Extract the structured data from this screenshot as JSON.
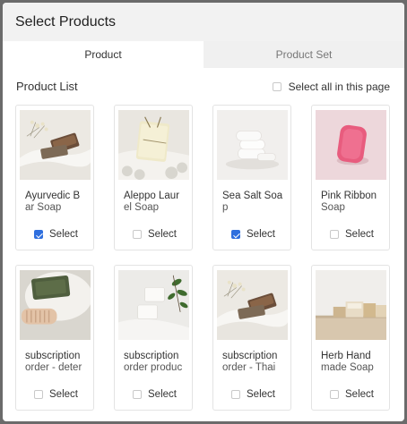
{
  "modal": {
    "title": "Select Products"
  },
  "tabs": [
    {
      "label": "Product",
      "active": true
    },
    {
      "label": "Product Set",
      "active": false
    }
  ],
  "list": {
    "title": "Product List",
    "select_all_label": "Select all in this page",
    "select_all_checked": false
  },
  "select_label": "Select",
  "products": [
    {
      "name": "Ayurvedic Bar Soap",
      "line1": "Ayurvedic B",
      "line2": "ar Soap",
      "checked": true,
      "image": "soap-on-towel-with-flowers"
    },
    {
      "name": "Aleppo Laurel Soap",
      "line1": "Aleppo Laur",
      "line2": "el Soap",
      "checked": false,
      "image": "cream-soap-with-twine"
    },
    {
      "name": "Sea Salt Soap",
      "line1": "Sea Salt Soa",
      "line2": "p",
      "checked": true,
      "image": "stacked-white-soaps"
    },
    {
      "name": "Pink Ribbon Soap",
      "line1": "Pink Ribbon",
      "line2": "Soap",
      "checked": false,
      "image": "pink-soap-bar"
    },
    {
      "name": "subscription order - detergent soap",
      "line1": "subscription",
      "line2": "order - deter",
      "checked": false,
      "image": "green-soap-with-brush"
    },
    {
      "name": "subscription order product - facial soap",
      "line1": "subscription",
      "line2": "order produc",
      "checked": false,
      "image": "white-soaps-with-leaves"
    },
    {
      "name": "subscription order - Thai soap",
      "line1": "subscription",
      "line2": "order - Thai",
      "checked": false,
      "image": "soap-on-towel-with-flowers"
    },
    {
      "name": "Herb Handmade Soap",
      "line1": "Herb Hand",
      "line2": "made Soap",
      "checked": false,
      "image": "soap-row-on-shelf"
    }
  ]
}
